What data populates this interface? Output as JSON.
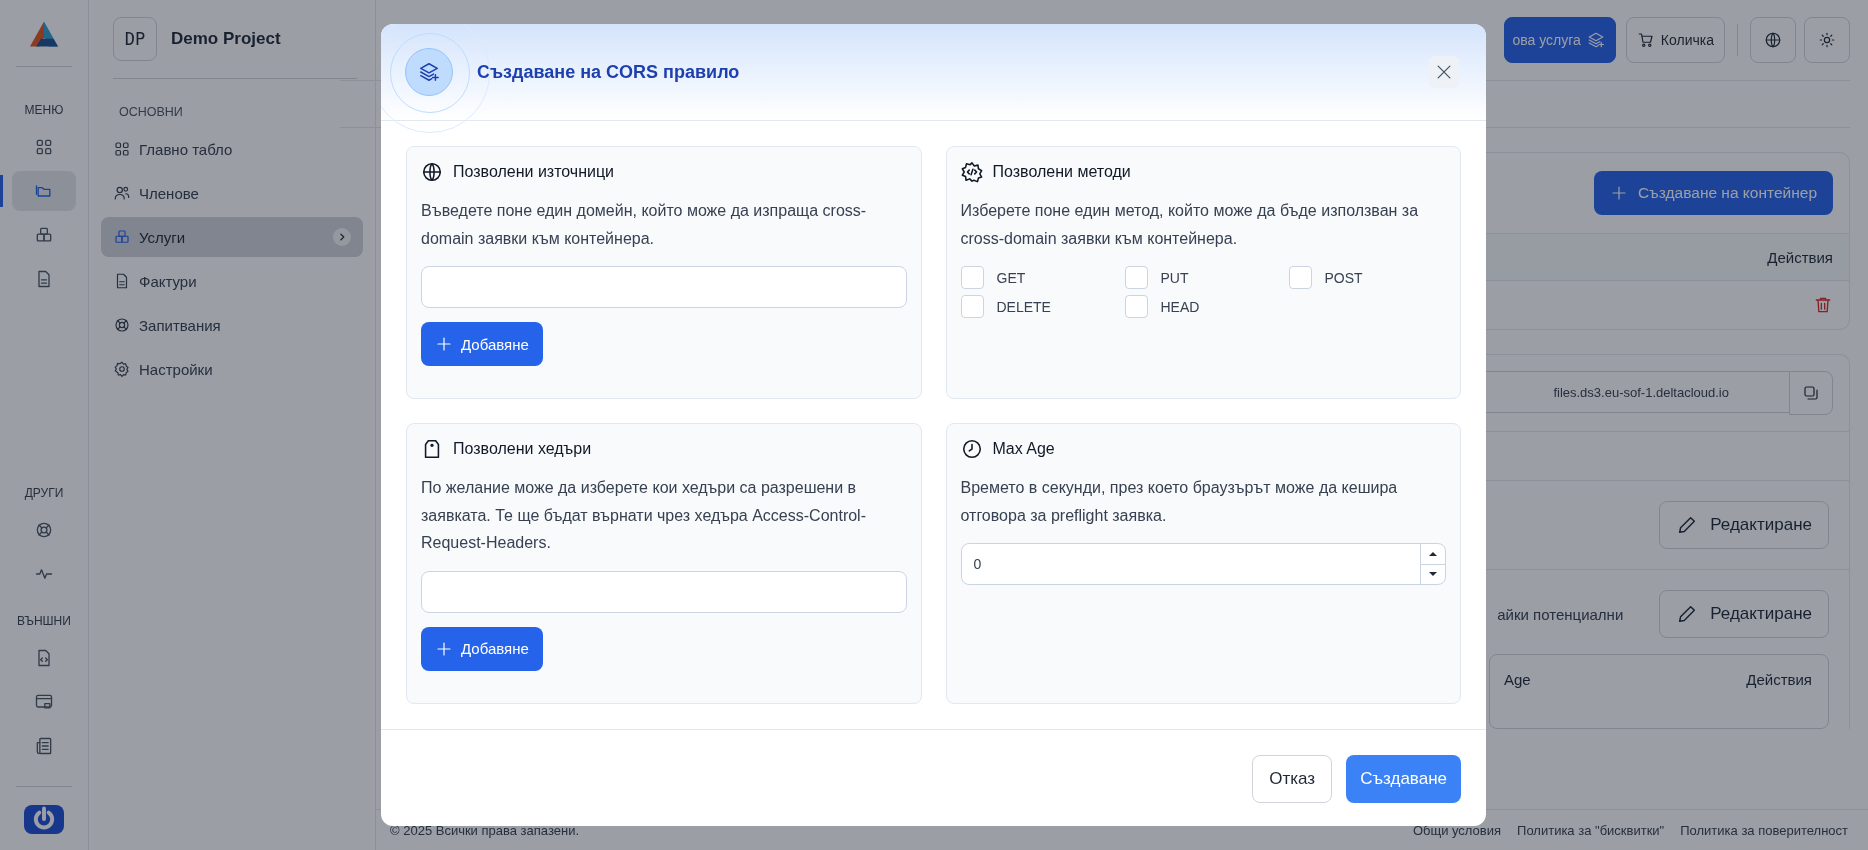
{
  "rail": {
    "sections": [
      {
        "title": "МЕНЮ",
        "items": [
          {
            "selected": false
          },
          {
            "selected": true
          },
          {
            "selected": false
          },
          {
            "selected": false
          }
        ]
      },
      {
        "title": "ДРУГИ",
        "items": [
          {
            "selected": false
          },
          {
            "selected": false
          }
        ]
      },
      {
        "title": "ВЪНШНИ",
        "items": [
          {
            "selected": false
          },
          {
            "selected": false
          },
          {
            "selected": false
          }
        ]
      }
    ]
  },
  "sidebar": {
    "project": {
      "initials": "DP",
      "name": "Demo Project"
    },
    "section": "ОСНОВНИ",
    "items": [
      {
        "label": "Главно табло",
        "selected": false
      },
      {
        "label": "Членове",
        "selected": false
      },
      {
        "label": "Услуги",
        "selected": true
      },
      {
        "label": "Фактури",
        "selected": false
      },
      {
        "label": "Запитвания",
        "selected": false
      },
      {
        "label": "Настройки",
        "selected": false
      }
    ]
  },
  "topbar": {
    "buttons": [
      {
        "label": "ова услуга",
        "kind": "primary"
      },
      {
        "label": "Количка",
        "kind": "outline"
      }
    ]
  },
  "content": {
    "create_container_button": "Създаване на контейнер",
    "table_header": "Действия",
    "endpoint": "files.ds3.eu-sof-1.deltacloud.io",
    "edit_buttons": [
      "Редактиране",
      "Редактиране"
    ],
    "note": "айки потенциални",
    "table2_columns": [
      "Age",
      "Действия"
    ]
  },
  "footer": {
    "copyright": "© 2025 Всички права запазени.",
    "links": [
      "Общи условия",
      "Политика за \"бисквитки\"",
      "Политика за поверителност"
    ]
  },
  "modal": {
    "title": "Създаване на CORS правило",
    "cards": [
      {
        "kind": "list",
        "title": "Позволени източници",
        "description": "Въведете поне един домейн, който може да изпраща cross-domain заявки към контейнера.",
        "button": "Добавяне"
      },
      {
        "kind": "checkboxes",
        "title": "Позволени методи",
        "description": "Изберете поне един метод, който може да бъде използван за cross-domain заявки към контейнера.",
        "options": [
          {
            "label": "GET",
            "checked": false
          },
          {
            "label": "PUT",
            "checked": false
          },
          {
            "label": "POST",
            "checked": false
          },
          {
            "label": "DELETE",
            "checked": false
          },
          {
            "label": "HEAD",
            "checked": false
          }
        ]
      },
      {
        "kind": "list",
        "title": "Позволени хедъри",
        "description": "По желание може да изберете кои хедъри са разрешени в заявката. Те ще бъдат върнати чрез хедъра Access-Control-Request-Headers.",
        "button": "Добавяне"
      },
      {
        "kind": "number",
        "title": "Max Age",
        "description": "Времето в секунди, през което браузърът може да кешира отговора за preflight заявка.",
        "value": "0"
      }
    ],
    "cancel": "Отказ",
    "submit": "Създаване"
  }
}
